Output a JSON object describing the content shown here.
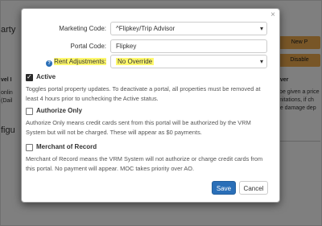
{
  "background": {
    "left_fragments": [
      "arty",
      "vel I",
      "onlin",
      "(Dail",
      "figu"
    ],
    "right_buttons": [
      "New P",
      "Disable"
    ],
    "right_fragments": [
      "aiver",
      "ll be given a price",
      "limitations, if ch",
      "the damage dep"
    ]
  },
  "modal": {
    "close_label": "×",
    "fields": {
      "marketing_code": {
        "label": "Marketing Code:",
        "value": "^Flipkey/Trip Advisor"
      },
      "portal_code": {
        "label": "Portal Code:",
        "value": "Flipkey"
      },
      "rent_adjustments": {
        "label": "Rent Adjustments:",
        "value": "No Override",
        "help_icon": "question-circle-icon"
      }
    },
    "options": [
      {
        "label": "Active",
        "checked": true,
        "description": "Toggles portal property updates. To deactivate a portal, all properties must be removed at least 4 hours prior to unchecking the Active status."
      },
      {
        "label": "Authorize Only",
        "checked": false,
        "description": "Authorize Only means credit cards sent from this portal will be authorized by the VRM System but will not be charged. These will appear as $0 payments."
      },
      {
        "label": "Merchant of Record",
        "checked": false,
        "description": "Merchant of Record means the VRM System will not authorize or charge credit cards from this portal. No payment will appear. MOC takes priority over AO."
      }
    ],
    "buttons": {
      "save": "Save",
      "cancel": "Cancel"
    }
  },
  "colors": {
    "primary": "#2a6fb8",
    "highlight": "#fff86b",
    "warning": "#f0ad4e",
    "overlay": "rgba(0,0,0,0.5)"
  }
}
